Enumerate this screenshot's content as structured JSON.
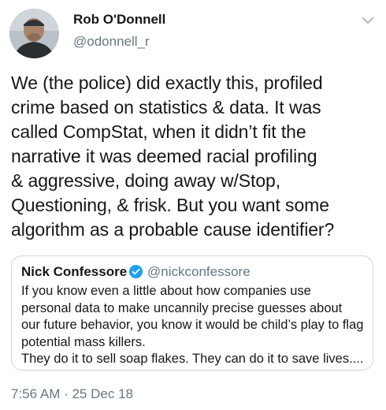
{
  "author": {
    "name": "Rob O'Donnell",
    "handle": "@odonnell_r"
  },
  "tweet": {
    "text": "We (the police) did exactly this, profiled\ncrime based on statistics & data. It was\ncalled CompStat, when it didn’t fit the\nnarrative it was deemed racial profiling\n& aggressive, doing away w/Stop,\nQuestioning, & frisk. But you want some\nalgorithm as a probable cause identifier?"
  },
  "quoted_tweet": {
    "author_name": "Nick Confessore",
    "author_handle": "@nickconfessore",
    "verified": true,
    "text": "If you know even a little about how companies use\npersonal data to make uncannily precise guesses about\nour future behavior, you know it would be child’s play to flag\npotential mass killers.\nThey do it to sell soap flakes. They can do it to save lives...."
  },
  "meta": {
    "timestamp": "7:56 AM · 25 Dec 18"
  },
  "colors": {
    "text": "#14171a",
    "secondary": "#657786",
    "border": "#ccd6dd",
    "verified": "#1da1f2"
  },
  "icons": {
    "menu": "chevron-down-icon",
    "verified": "verified-badge-icon"
  }
}
